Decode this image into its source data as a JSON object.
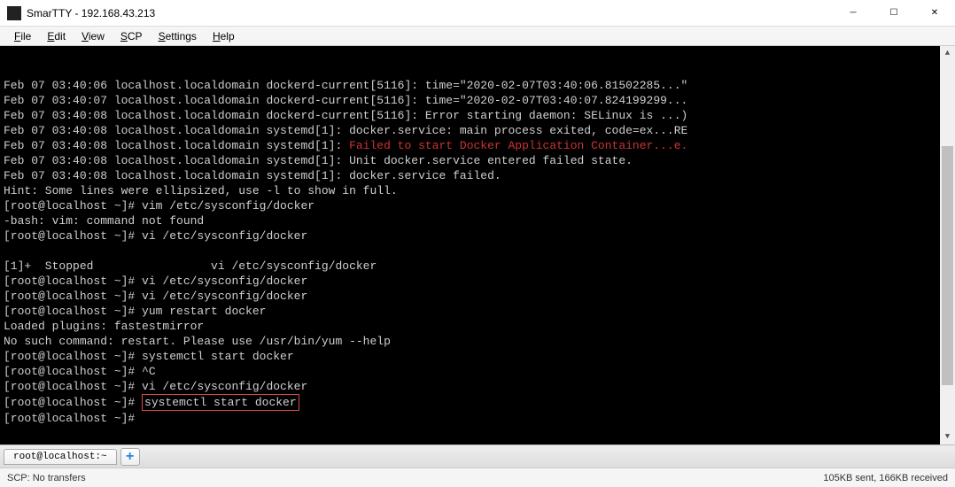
{
  "window": {
    "title": "SmarTTY - 192.168.43.213"
  },
  "menu": {
    "file": "File",
    "edit": "Edit",
    "view": "View",
    "scp": "SCP",
    "settings": "Settings",
    "help": "Help"
  },
  "terminal": {
    "lines": [
      {
        "text": "Feb 07 03:40:06 localhost.localdomain dockerd-current[5116]: time=\"2020-02-07T03:40:06.81502285...\""
      },
      {
        "text": "Feb 07 03:40:07 localhost.localdomain dockerd-current[5116]: time=\"2020-02-07T03:40:07.824199299..."
      },
      {
        "text": "Feb 07 03:40:08 localhost.localdomain dockerd-current[5116]: Error starting daemon: SELinux is ...)"
      },
      {
        "text": "Feb 07 03:40:08 localhost.localdomain systemd[1]: docker.service: main process exited, code=ex...RE"
      },
      {
        "prefix": "Feb 07 03:40:08 localhost.localdomain systemd[1]: ",
        "highlighted": "Failed to start Docker Application Container...e."
      },
      {
        "text": "Feb 07 03:40:08 localhost.localdomain systemd[1]: Unit docker.service entered failed state."
      },
      {
        "text": "Feb 07 03:40:08 localhost.localdomain systemd[1]: docker.service failed."
      },
      {
        "text": "Hint: Some lines were ellipsized, use -l to show in full."
      },
      {
        "text": "[root@localhost ~]# vim /etc/sysconfig/docker"
      },
      {
        "text": "-bash: vim: command not found"
      },
      {
        "text": "[root@localhost ~]# vi /etc/sysconfig/docker"
      },
      {
        "text": ""
      },
      {
        "text": "[1]+  Stopped                 vi /etc/sysconfig/docker"
      },
      {
        "text": "[root@localhost ~]# vi /etc/sysconfig/docker"
      },
      {
        "text": "[root@localhost ~]# vi /etc/sysconfig/docker"
      },
      {
        "text": "[root@localhost ~]# yum restart docker"
      },
      {
        "text": "Loaded plugins: fastestmirror"
      },
      {
        "text": "No such command: restart. Please use /usr/bin/yum --help"
      },
      {
        "text": "[root@localhost ~]# systemctl start docker"
      },
      {
        "text": "[root@localhost ~]# ^C"
      },
      {
        "text": "[root@localhost ~]# vi /etc/sysconfig/docker"
      },
      {
        "prefix": "[root@localhost ~]# ",
        "boxed": "systemctl start docker"
      },
      {
        "text": "[root@localhost ~]# "
      }
    ]
  },
  "tabs": {
    "tab1": "root@localhost:~"
  },
  "status": {
    "left": "SCP: No transfers",
    "right": "105KB sent, 166KB received"
  }
}
